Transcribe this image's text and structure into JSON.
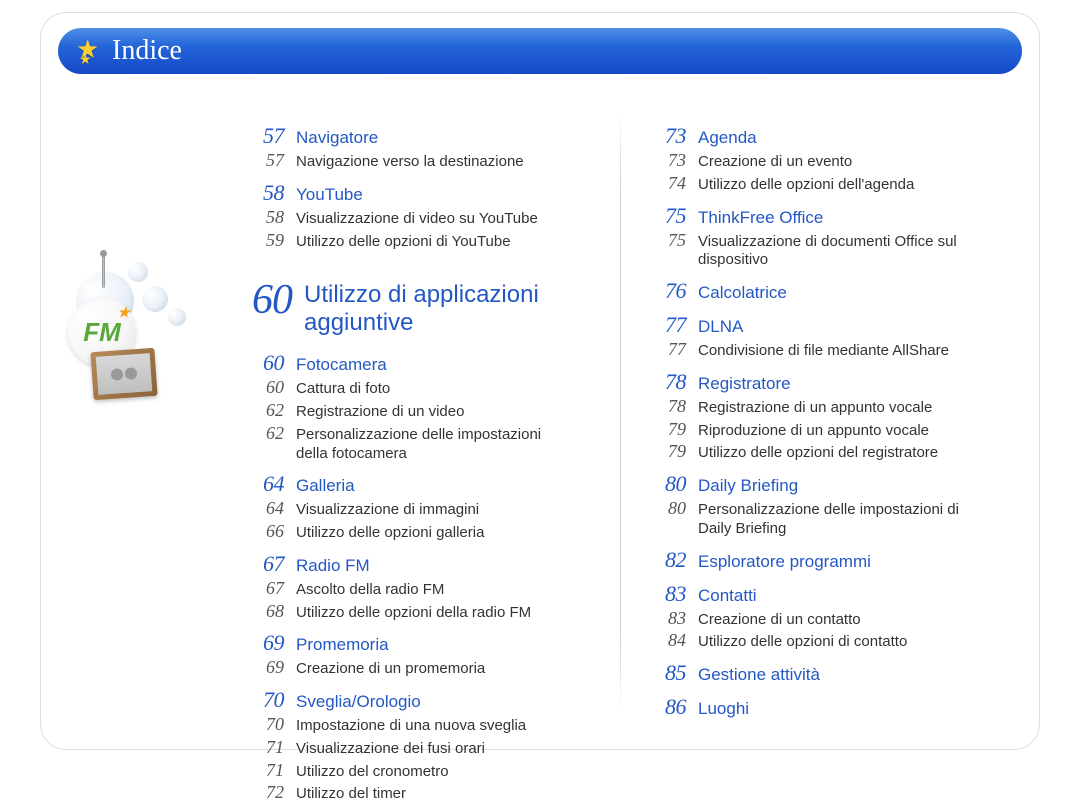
{
  "header": {
    "title": "Indice"
  },
  "illustration": {
    "fm_label": "FM"
  },
  "left": {
    "pre_sections": [
      {
        "num": "57",
        "title": "Navigatore",
        "items": [
          {
            "num": "57",
            "text": "Navigazione verso la destinazione"
          }
        ]
      },
      {
        "num": "58",
        "title": "YouTube",
        "items": [
          {
            "num": "58",
            "text": "Visualizzazione di video su YouTube"
          },
          {
            "num": "59",
            "text": "Utilizzo delle opzioni di YouTube"
          }
        ]
      }
    ],
    "chapter": {
      "num": "60",
      "title": "Utilizzo di applicazioni aggiuntive"
    },
    "post_sections": [
      {
        "num": "60",
        "title": "Fotocamera",
        "items": [
          {
            "num": "60",
            "text": "Cattura di foto"
          },
          {
            "num": "62",
            "text": "Registrazione di un video"
          },
          {
            "num": "62",
            "text": "Personalizzazione delle impostazioni della fotocamera"
          }
        ]
      },
      {
        "num": "64",
        "title": "Galleria",
        "items": [
          {
            "num": "64",
            "text": "Visualizzazione di immagini"
          },
          {
            "num": "66",
            "text": "Utilizzo delle opzioni galleria"
          }
        ]
      },
      {
        "num": "67",
        "title": "Radio FM",
        "items": [
          {
            "num": "67",
            "text": "Ascolto della radio FM"
          },
          {
            "num": "68",
            "text": "Utilizzo delle opzioni della radio FM"
          }
        ]
      },
      {
        "num": "69",
        "title": "Promemoria",
        "items": [
          {
            "num": "69",
            "text": "Creazione di un promemoria"
          }
        ]
      },
      {
        "num": "70",
        "title": "Sveglia/Orologio",
        "items": [
          {
            "num": "70",
            "text": "Impostazione di una nuova sveglia"
          },
          {
            "num": "71",
            "text": "Visualizzazione dei fusi orari"
          },
          {
            "num": "71",
            "text": "Utilizzo del cronometro"
          },
          {
            "num": "72",
            "text": "Utilizzo del timer"
          }
        ]
      }
    ]
  },
  "right": {
    "sections": [
      {
        "num": "73",
        "title": "Agenda",
        "items": [
          {
            "num": "73",
            "text": "Creazione di un evento"
          },
          {
            "num": "74",
            "text": "Utilizzo delle opzioni dell'agenda"
          }
        ]
      },
      {
        "num": "75",
        "title": "ThinkFree Office",
        "items": [
          {
            "num": "75",
            "text": "Visualizzazione di documenti Office sul dispositivo"
          }
        ]
      },
      {
        "num": "76",
        "title": "Calcolatrice",
        "items": []
      },
      {
        "num": "77",
        "title": "DLNA",
        "items": [
          {
            "num": "77",
            "text": "Condivisione di file mediante AllShare"
          }
        ]
      },
      {
        "num": "78",
        "title": "Registratore",
        "items": [
          {
            "num": "78",
            "text": "Registrazione di un appunto vocale"
          },
          {
            "num": "79",
            "text": "Riproduzione di un appunto vocale"
          },
          {
            "num": "79",
            "text": "Utilizzo delle opzioni del registratore"
          }
        ]
      },
      {
        "num": "80",
        "title": "Daily Briefing",
        "items": [
          {
            "num": "80",
            "text": "Personalizzazione delle impostazioni di Daily Briefing"
          }
        ]
      },
      {
        "num": "82",
        "title": "Esploratore programmi",
        "items": []
      },
      {
        "num": "83",
        "title": "Contatti",
        "items": [
          {
            "num": "83",
            "text": "Creazione di un contatto"
          },
          {
            "num": "84",
            "text": "Utilizzo delle opzioni di contatto"
          }
        ]
      },
      {
        "num": "85",
        "title": "Gestione attività",
        "items": []
      },
      {
        "num": "86",
        "title": "Luoghi",
        "items": []
      }
    ]
  }
}
